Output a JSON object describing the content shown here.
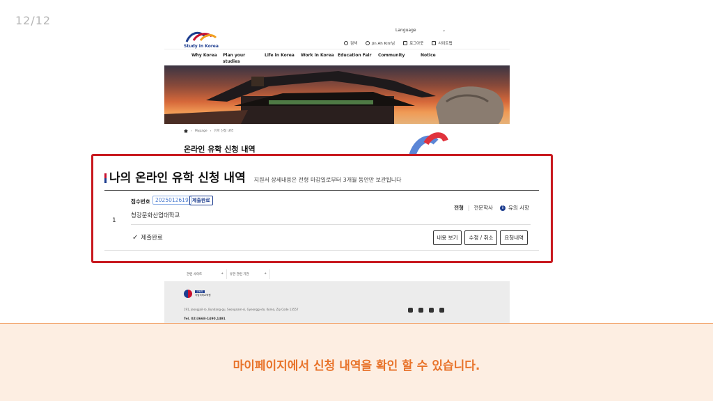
{
  "slide": {
    "counter": "12/12"
  },
  "site": {
    "language": "Language",
    "logo_text": "Study in Korea",
    "util_links": [
      "검색",
      "Jin Ah Kim님",
      "로그아웃",
      "사이트맵"
    ],
    "gnb": [
      "Why Korea",
      "Plan your studies",
      "Life in Korea",
      "Work in Korea",
      "Education Fair",
      "Community",
      "Notice"
    ],
    "breadcrumb": [
      "Mypage",
      "유학 신청 내역"
    ],
    "page_title": "온라인 유학 신청 내역",
    "footer_tabs": [
      "관련 사이트",
      "유관 관련 기관"
    ],
    "ministry_badge": "교육부",
    "ministry_name": "국립국제교육원",
    "address": "191, Jeongjail-ro, Bundang-gu, Seongnam-si, Gyeonggi-do, Korea, Zip Code 13557",
    "tel": "Tel. 02)3668-1490,1491"
  },
  "panel": {
    "title": "나의 온라인 유학 신청 내역",
    "subtitle": "지원서 상세내용은 전형 마감일로부터 3개월 동안만 보관됩니다",
    "row_number": "1",
    "application_label": "접수번호",
    "application_id": "2025012619",
    "status_badge": "제출완료",
    "school_name": "청강문화산업대학교",
    "type_label": "전형",
    "type_value": "전문학사",
    "notice_link": "유의 사항",
    "status_text": "제출완료",
    "buttons": {
      "view": "내용 보기",
      "edit_cancel": "수정 / 취소",
      "request": "요청내역"
    }
  },
  "caption": "마이페이지에서 신청 내역을 확인 할 수 있습니다.",
  "colors": {
    "highlight": "#c8181e",
    "caption": "#e8732a",
    "caption_band": "#fdeee2",
    "brand_blue": "#1d3d8f"
  }
}
